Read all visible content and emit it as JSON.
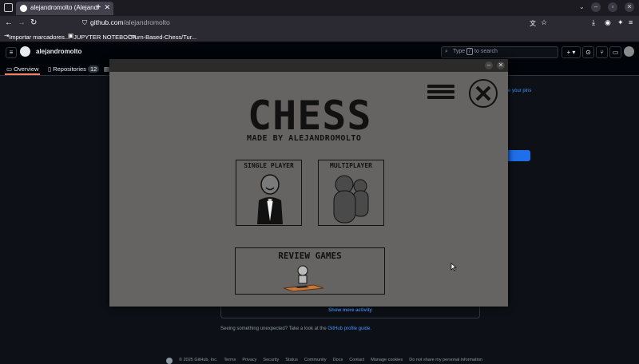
{
  "browser": {
    "tab_title": "alejandromolto (Alejandr",
    "url_host": "github.com",
    "url_path": "/alejandromolto",
    "bookmarks": [
      "Importar marcadores...",
      "JUPYTER NOTEBOOK",
      "Turn-Based-Chess/Tur..."
    ]
  },
  "github": {
    "username": "alejandromolto",
    "search_placeholder_pre": "Type",
    "search_key": "/",
    "search_placeholder_post": "to search",
    "tabs": [
      {
        "label": "Overview"
      },
      {
        "label": "Repositories",
        "count": "12"
      }
    ],
    "pins_text": "e your pins",
    "show_more": "Show more activity",
    "unexpected_pre": "Seeing something unexpected? Take a look at the ",
    "unexpected_link": "GitHub profile guide",
    "unexpected_post": ".",
    "footer": [
      "© 2025 GitHub, Inc.",
      "Terms",
      "Privacy",
      "Security",
      "Status",
      "Community",
      "Docs",
      "Contact",
      "Manage cookies",
      "Do not share my personal information"
    ]
  },
  "game": {
    "title": "CHESS",
    "made_by": "MADE BY ALEJANDROMOLTO",
    "single_player": "SINGLE PLAYER",
    "multiplayer": "MULTIPLAYER",
    "review_games": "REVIEW GAMES",
    "background": "#656463"
  }
}
